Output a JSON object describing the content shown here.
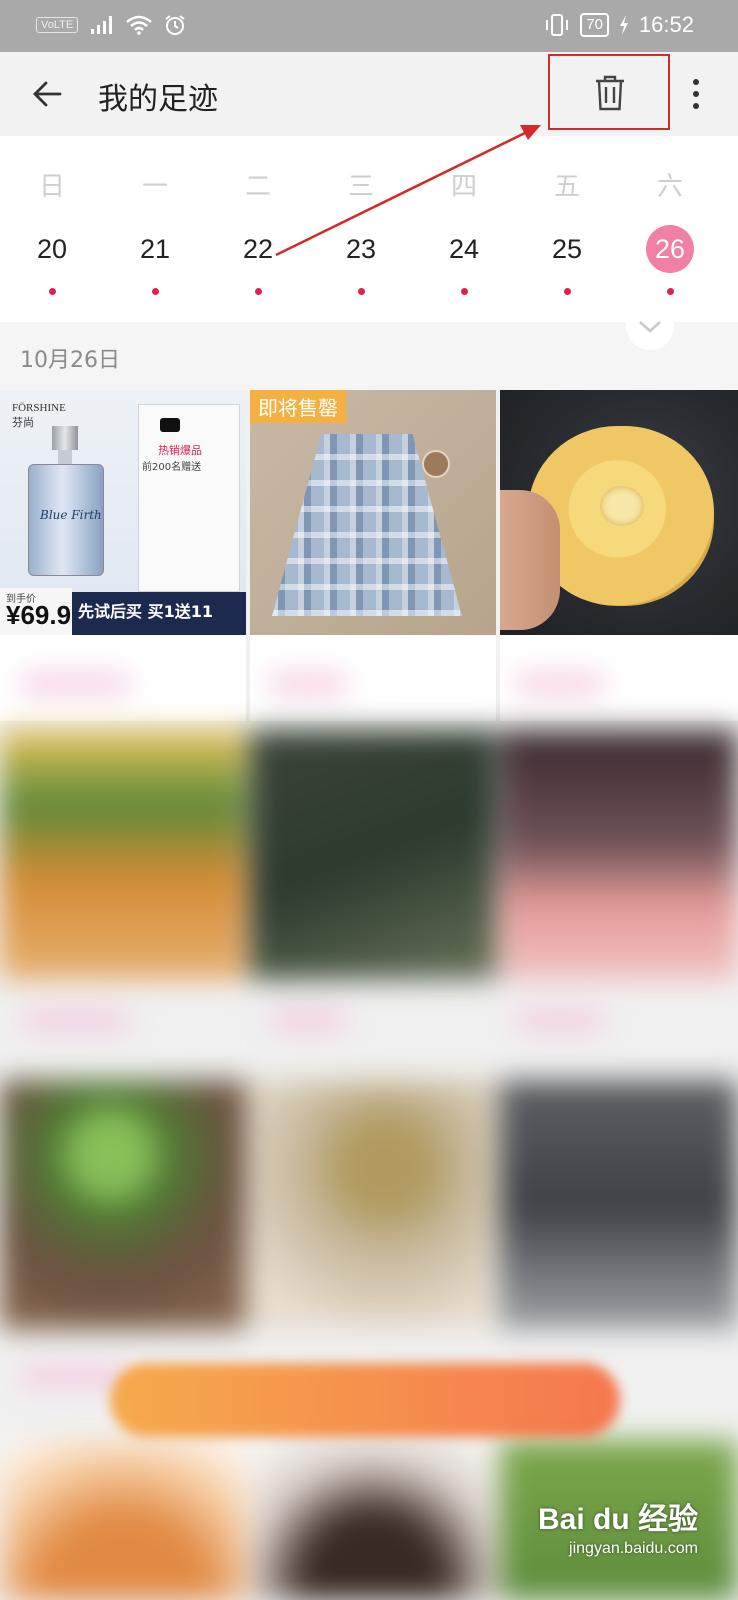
{
  "status_bar": {
    "network_label": "VoLTE",
    "battery": "70",
    "time": "16:52",
    "icons": [
      "signal-icon",
      "wifi-icon",
      "alarm-icon",
      "vibrate-icon",
      "battery-icon",
      "charging-icon"
    ]
  },
  "header": {
    "title": "我的足迹",
    "icons": [
      "back-arrow-icon",
      "trash-icon",
      "more-vertical-icon"
    ]
  },
  "calendar": {
    "weekdays": [
      "日",
      "一",
      "二",
      "三",
      "四",
      "五",
      "六"
    ],
    "days": [
      "20",
      "21",
      "22",
      "23",
      "24",
      "25",
      "26"
    ],
    "selected_day": "26",
    "accent_color": "#f080a4",
    "dot_color": "#e0204f"
  },
  "section": {
    "date_label": "10月26日"
  },
  "items": [
    {
      "brand": "FÖRSHINE",
      "brand_sub": "芬尚",
      "bottle_text": "Blue Firth",
      "hot_label": "热销爆品",
      "hot_sub": "前200名赠送",
      "price_label": "到手价",
      "price": "¥69.9",
      "promo": "先试后买 买1送11"
    },
    {
      "badge": "即将售罄",
      "badge_color": "#f5b042"
    },
    {
      "image": "pepino-melon"
    }
  ],
  "watermark": {
    "logo": "Bai du 经验",
    "url": "jingyan.baidu.com"
  },
  "annotation_color": "#d42a2a"
}
